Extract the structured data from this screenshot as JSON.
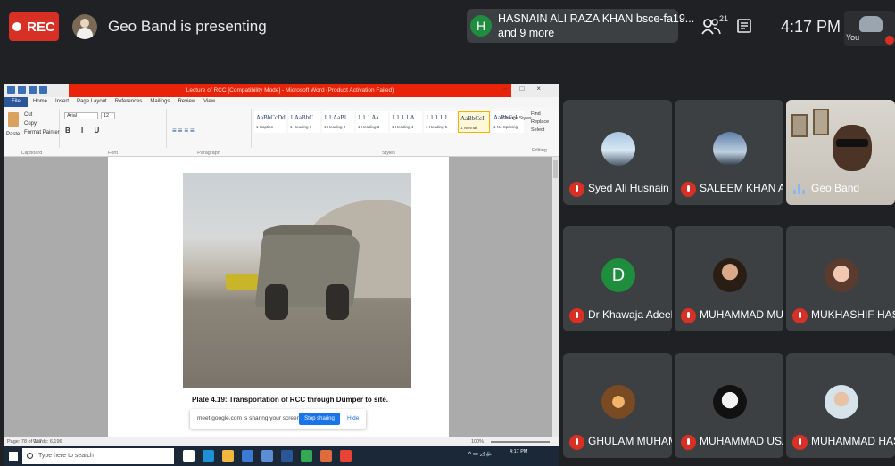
{
  "meeting": {
    "rec_label": "REC",
    "presenting_text": "Geo Band is presenting",
    "notification": {
      "avatar_letter": "H",
      "line1": "HASNAIN ALI RAZA KHAN bsce-fa19...",
      "line2": "and 9 more"
    },
    "participant_count": "21",
    "clock": "4:17 PM",
    "self_label": "You"
  },
  "word": {
    "title": "Lecture of RCC [Compatibility Mode] - Microsoft Word (Product Activation Failed)",
    "menu_file": "File",
    "menu_tabs": [
      "Home",
      "Insert",
      "Page Layout",
      "References",
      "Mailings",
      "Review",
      "View"
    ],
    "clipboard": {
      "cut": "Cut",
      "copy": "Copy",
      "paste": "Paste",
      "format_painter": "Format Painter",
      "label": "Clipboard"
    },
    "font_name": "Arial",
    "font_size": "12",
    "font_label": "Font",
    "paragraph_label": "Paragraph",
    "styles_label": "Styles",
    "editing_label": "Editing",
    "styles": [
      {
        "preview": "AaBbCcDd",
        "name": "1 Caption"
      },
      {
        "preview": "1 AaBbC",
        "name": "1 Heading 1"
      },
      {
        "preview": "1.1 AaBl",
        "name": "1 Heading 2"
      },
      {
        "preview": "1.1.1 Aa",
        "name": "1 Heading 3"
      },
      {
        "preview": "1.1.1.1 A",
        "name": "1 Heading 4"
      },
      {
        "preview": "1.1.1.1.1",
        "name": "1 Heading 5"
      },
      {
        "preview": "AaBbCcI",
        "name": "1 Normal"
      },
      {
        "preview": "AaBbCcI",
        "name": "1 No Spacing"
      }
    ],
    "change_styles": "Change Styles",
    "find": "Find",
    "replace": "Replace",
    "select": "Select",
    "caption": "Plate 4.19:    Transportation of RCC through Dumper to site.",
    "page_info": "Page: 78 of 157",
    "word_count": "Words: 6,196",
    "zoom": "100%",
    "share_text": "meet.google.com is sharing your screen.",
    "stop_sharing": "Stop sharing",
    "hide": "Hide",
    "taskbar_search": "Type here to search",
    "tray_time": "4:17 PM"
  },
  "participants": [
    {
      "name": "Syed Ali Husnain",
      "muted": true,
      "avatar": "av-pic1"
    },
    {
      "name": "SALEEM KHAN AL...",
      "muted": true,
      "avatar": "av-pic2"
    },
    {
      "name": "Geo Band",
      "muted": false,
      "avatar": "video"
    },
    {
      "name": "Dr Khawaja Adeel ...",
      "muted": true,
      "avatar": "letter",
      "letter": "D"
    },
    {
      "name": "MUHAMMAD MU...",
      "muted": true,
      "avatar": "av-pic3"
    },
    {
      "name": "MUKHASHIF HAS...",
      "muted": true,
      "avatar": "av-pic4"
    },
    {
      "name": "GHULAM MUHAM...",
      "muted": true,
      "avatar": "av-pic5"
    },
    {
      "name": "MUHAMMAD USA...",
      "muted": true,
      "avatar": "av-pic6"
    },
    {
      "name": "MUHAMMAD HAS...",
      "muted": true,
      "avatar": "av-pic7"
    }
  ],
  "colors": {
    "rec": "#d93025",
    "muted_mic": "#d93025",
    "word_title_bar": "#e8230a",
    "meet_bg": "#202124",
    "tile_bg": "#3c4043"
  }
}
